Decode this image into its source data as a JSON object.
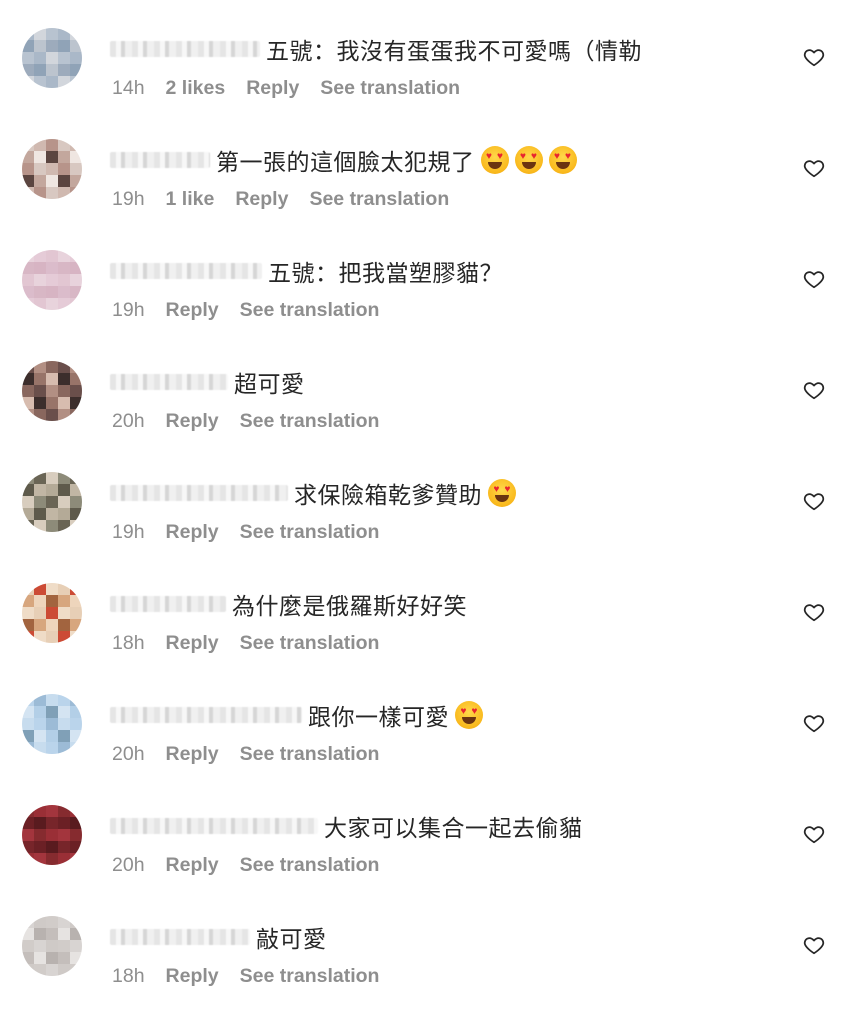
{
  "comments": [
    {
      "username_width": 150,
      "text": "五號：我沒有蛋蛋我不可愛嗎（情勒",
      "emoji_count": 0,
      "time": "14h",
      "likes": "2 likes",
      "reply": "Reply",
      "translation": "See translation",
      "avatar_palette": [
        "#a9b8c9",
        "#c9cdd6",
        "#8fa3b8",
        "#d6dbe2",
        "#b7c3d1",
        "#e2e4e8",
        "#9cabbd",
        "#c0c7d0",
        "#d2d6dc",
        "#aeb9c6",
        "#bcc4cf",
        "#e6e8eb"
      ]
    },
    {
      "username_width": 100,
      "text": "第一張的這個臉太犯規了",
      "emoji_count": 3,
      "time": "19h",
      "likes": "1 like",
      "reply": "Reply",
      "translation": "See translation",
      "avatar_palette": [
        "#d9c8c0",
        "#7a5a52",
        "#c4a79c",
        "#3f2e2b",
        "#b89489",
        "#e8ddd7",
        "#5c4540",
        "#a87f74",
        "#d1b9af",
        "#8c6a61",
        "#efe6e1",
        "#6e514a"
      ]
    },
    {
      "username_width": 152,
      "text": "五號：把我當塑膠貓？",
      "emoji_count": 0,
      "time": "19h",
      "likes": "",
      "reply": "Reply",
      "translation": "See translation",
      "avatar_palette": [
        "#e9d3dc",
        "#f2e4ea",
        "#d9b7c5",
        "#ecd9e1",
        "#e3c6d2",
        "#f6eef2",
        "#dcbccb",
        "#eed9e2",
        "#e6cbd7",
        "#f3e7ed",
        "#d8b4c3",
        "#efdfe6"
      ]
    },
    {
      "username_width": 118,
      "text": "超可愛",
      "emoji_count": 0,
      "time": "20h",
      "likes": "",
      "reply": "Reply",
      "translation": "See translation",
      "avatar_palette": [
        "#6b4f4a",
        "#a47e73",
        "#3d2e2c",
        "#c9a596",
        "#8a675d",
        "#5a4440",
        "#d8bcae",
        "#7d5c54",
        "#b48f82",
        "#4a3835",
        "#9a7468",
        "#e0c9bd"
      ]
    },
    {
      "username_width": 178,
      "text": "求保險箱乾爹贊助",
      "emoji_count": 1,
      "time": "19h",
      "likes": "",
      "reply": "Reply",
      "translation": "See translation",
      "avatar_palette": [
        "#8d8b78",
        "#c7b9a6",
        "#5e5a4a",
        "#a89f8b",
        "#d8cdbd",
        "#746f5e",
        "#b5aa96",
        "#e4dbcf",
        "#6a6554",
        "#9c937f",
        "#c2b6a3",
        "#857f6b"
      ]
    },
    {
      "username_width": 116,
      "text": "為什麼是俄羅斯好好笑",
      "emoji_count": 0,
      "time": "18h",
      "likes": "",
      "reply": "Reply",
      "translation": "See translation",
      "avatar_palette": [
        "#e8cfb4",
        "#b97a4e",
        "#d9a67c",
        "#8c4f2e",
        "#f0dcc6",
        "#c68a5c",
        "#a5633c",
        "#e3c0a0",
        "#d14a32",
        "#b06a42",
        "#efd5bb",
        "#9a5a36"
      ]
    },
    {
      "username_width": 192,
      "text": "跟你一樣可愛",
      "emoji_count": 1,
      "time": "20h",
      "likes": "",
      "reply": "Reply",
      "translation": "See translation",
      "avatar_palette": [
        "#b9d4ec",
        "#9ec3e4",
        "#d3e4f3",
        "#8fb4d6",
        "#c6dcef",
        "#a8c9e6",
        "#7fa0b8",
        "#dbe9f5",
        "#9bbbd8",
        "#6f8b6a",
        "#b2cfe9",
        "#c9dff1"
      ]
    },
    {
      "username_width": 208,
      "text": "大家可以集合一起去偷貓",
      "emoji_count": 0,
      "time": "20h",
      "likes": "",
      "reply": "Reply",
      "translation": "See translation",
      "avatar_palette": [
        "#8a2a2e",
        "#c45058",
        "#6e1f24",
        "#d8a9b0",
        "#a8343c",
        "#e8d0d4",
        "#7a2429",
        "#b9878e",
        "#9e2e35",
        "#f0e2e4",
        "#5c1a1e",
        "#c97a82"
      ]
    },
    {
      "username_width": 140,
      "text": "敲可愛",
      "emoji_count": 0,
      "time": "18h",
      "likes": "",
      "reply": "Reply",
      "translation": "See translation",
      "avatar_palette": [
        "#d8d4d2",
        "#c9c4c1",
        "#e6e3e1",
        "#bdb7b4",
        "#d1ccc9",
        "#ece9e7",
        "#c4bebb",
        "#dcd8d6",
        "#cfcac7",
        "#e1dddb",
        "#b8b2af",
        "#d6d1ce"
      ]
    }
  ],
  "icons": {
    "like": "heart-outline-icon",
    "emoji": "smiling-face-with-heart-eyes"
  },
  "colors": {
    "primary_text": "#262626",
    "secondary_text": "#8e8e8e",
    "background": "#ffffff"
  }
}
